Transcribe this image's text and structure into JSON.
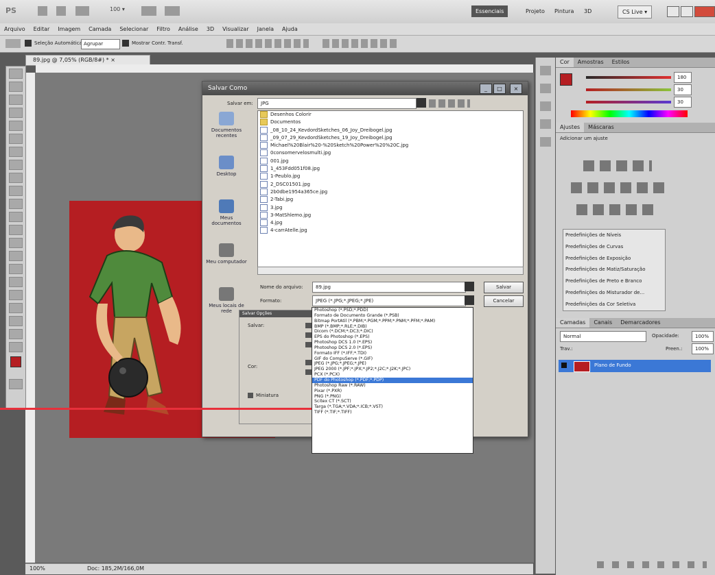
{
  "appbar": {
    "logo": "PS",
    "zoom": "100 ▾",
    "workspaces": [
      "Essenciais",
      "Projeto",
      "Pintura",
      "3D"
    ],
    "cslive": "CS Live ▾"
  },
  "menubar": {
    "items": [
      "Arquivo",
      "Editar",
      "Imagem",
      "Camada",
      "Selecionar",
      "Filtro",
      "Análise",
      "3D",
      "Visualizar",
      "Janela",
      "Ajuda"
    ]
  },
  "options": {
    "auto_select": "Seleção Automática:",
    "auto_select_value": "Agrupar",
    "transform_controls": "Mostrar Contr. Transf."
  },
  "document": {
    "tab": "89.jpg @ 7,05% (RGB/8#) * ×",
    "zoom": "100%",
    "doc_info": "Doc: 185,2M/166,0M"
  },
  "dialog": {
    "title": "Salvar Como",
    "save_in_label": "Salvar em:",
    "save_in_value": "JPG",
    "places": [
      "Documentos recentes",
      "Desktop",
      "Meus documentos",
      "Meu computador",
      "Meus locais de rede"
    ],
    "files": [
      {
        "name": "Desenhos Colorir",
        "type": "folder"
      },
      {
        "name": "Documentos",
        "type": "folder"
      },
      {
        "name": "_08_10_24_KevdordSketches_06_Joy_Dreibogel.jpg",
        "type": "jpg"
      },
      {
        "name": "_09_07_29_KevdordSketches_19_Joy_Dreibogel.jpg",
        "type": "jpg"
      },
      {
        "name": "Michael%20Blair%20-%20Sketch%20Power%20%20C.jpg",
        "type": "jpg"
      },
      {
        "name": "0consomervelosmulti.jpg",
        "type": "jpg"
      },
      {
        "name": "001.jpg",
        "type": "jpg"
      },
      {
        "name": "1_453Fdd051f08.jpg",
        "type": "jpg"
      },
      {
        "name": "1-Peublo.jpg",
        "type": "jpg"
      },
      {
        "name": "2_DSC01501.jpg",
        "type": "jpg"
      },
      {
        "name": "2b0dbe1954a365ce.jpg",
        "type": "jpg"
      },
      {
        "name": "2-Tabi.jpg",
        "type": "jpg"
      },
      {
        "name": "3.jpg",
        "type": "jpg"
      },
      {
        "name": "3-MatShlemo.jpg",
        "type": "jpg"
      },
      {
        "name": "4.jpg",
        "type": "jpg"
      },
      {
        "name": "4-carrAtelle.jpg",
        "type": "jpg"
      }
    ],
    "filename_label": "Nome do arquivo:",
    "filename_value": "89.jpg",
    "format_label": "Formato:",
    "format_value": "JPEG (*.JPG;*.JPEG;*.JPE)",
    "save_button": "Salvar",
    "cancel_button": "Cancelar",
    "save_options_title": "Salvar Opções",
    "save_label": "Salvar:",
    "color_label": "Cor:",
    "thumbnail_label": "Miniatura",
    "formats": [
      "Photoshop (*.PSD;*.PDD)",
      "Formato de Documento Grande (*.PSB)",
      "Bitmap PortÁtil (*.PBM;*.PGM;*.PPM;*.PNM;*.PFM;*.PAM)",
      "BMP (*.BMP;*.RLE;*.DIB)",
      "Dicom (*.DCM;*.DC3;*.DIC)",
      "EPS do Photoshop (*.EPS)",
      "Photoshop DCS 1.0 (*.EPS)",
      "Photoshop DCS 2.0 (*.EPS)",
      "Formato IFF (*.IFF;*.TDI)",
      "GIF do CompuServe (*.GIF)",
      "JPEG (*.JPG;*.JPEG;*.JPE)",
      "JPEG 2000 (*.JPF;*.JPX;*.JP2;*.J2C;*.J2K;*.JPC)",
      "PCX (*.PCX)",
      "PDF do Photoshop (*.PDF;*.PDP)",
      "Photoshop Raw (*.RAW)",
      "Pixar (*.PXR)",
      "PNG (*.PNG)",
      "Scitex CT (*.SCT)",
      "Targa (*.TGA;*.VDA;*.ICB;*.VST)",
      "TIFF (*.TIF;*.TIFF)"
    ],
    "selected_format_index": 13
  },
  "panels": {
    "color_tabs": [
      "Cor",
      "Amostras",
      "Estilos"
    ],
    "color_values": [
      "180",
      "30",
      "30"
    ],
    "adjust_tabs": [
      "Ajustes",
      "Máscaras"
    ],
    "adjust_title": "Adicionar um ajuste",
    "presets": [
      "Predefinições de Níveis",
      "Predefinições de Curvas",
      "Predefinições de Exposição",
      "Predefinições de Matiz/Saturação",
      "Predefinições de Preto e Branco",
      "Predefinições do Misturador de...",
      "Predefinições da Cor Seletiva"
    ],
    "layer_tabs": [
      "Camadas",
      "Canais",
      "Demarcadores"
    ],
    "blend_mode": "Normal",
    "opacity_label": "Opacidade:",
    "opacity_value": "100%",
    "lock_label": "Trav.:",
    "fill_label": "Preen.:",
    "fill_value": "100%",
    "layer_name": "Plano de Fundo"
  },
  "colors": {
    "accent": "#3b78d6",
    "artboard": "#b51e22",
    "marker": "#e8303b"
  }
}
